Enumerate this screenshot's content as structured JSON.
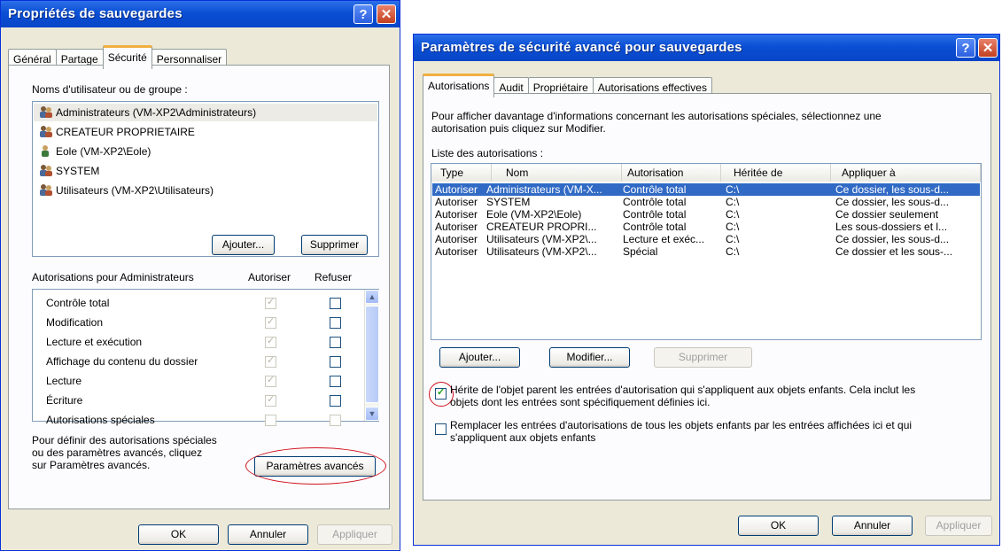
{
  "left": {
    "title": "Propriétés de sauvegardes",
    "tabs": [
      "Général",
      "Partage",
      "Sécurité",
      "Personnaliser"
    ],
    "group_label": "Noms d'utilisateur ou de groupe :",
    "users": [
      "Administrateurs (VM-XP2\\Administrateurs)",
      "CREATEUR PROPRIETAIRE",
      "Eole (VM-XP2\\Eole)",
      "SYSTEM",
      "Utilisateurs (VM-XP2\\Utilisateurs)"
    ],
    "add_button": "Ajouter...",
    "remove_button": "Supprimer",
    "perms_header": "Autorisations pour Administrateurs",
    "allow_header": "Autoriser",
    "deny_header": "Refuser",
    "permissions": [
      "Contrôle total",
      "Modification",
      "Lecture et exécution",
      "Affichage du contenu du dossier",
      "Lecture",
      "Écriture",
      "Autorisations spéciales"
    ],
    "advanced_text": [
      "Pour définir des autorisations spéciales",
      "ou des paramètres avancés, cliquez",
      "sur Paramètres avancés."
    ],
    "advanced_button": "Paramètres avancés",
    "ok": "OK",
    "cancel": "Annuler",
    "apply": "Appliquer"
  },
  "right": {
    "title": "Paramètres de sécurité avancé pour sauvegardes",
    "tabs": [
      "Autorisations",
      "Audit",
      "Propriétaire",
      "Autorisations effectives"
    ],
    "info": [
      "Pour afficher davantage d'informations concernant les autorisations spéciales, sélectionnez une",
      "autorisation puis cliquez sur Modifier."
    ],
    "list_label": "Liste des autorisations :",
    "columns": [
      "Type",
      "Nom",
      "Autorisation",
      "Héritée de",
      "Appliquer à"
    ],
    "rows": [
      [
        "Autoriser",
        "Administrateurs (VM-X...",
        "Contrôle total",
        "C:\\",
        "Ce dossier, les sous-d..."
      ],
      [
        "Autoriser",
        "SYSTEM",
        "Contrôle total",
        "C:\\",
        "Ce dossier, les sous-d..."
      ],
      [
        "Autoriser",
        "Eole (VM-XP2\\Eole)",
        "Contrôle total",
        "C:\\",
        "Ce dossier seulement"
      ],
      [
        "Autoriser",
        "CREATEUR PROPRI...",
        "Contrôle total",
        "C:\\",
        "Les sous-dossiers et l..."
      ],
      [
        "Autoriser",
        "Utilisateurs (VM-XP2\\...",
        "Lecture et exéc...",
        "C:\\",
        "Ce dossier, les sous-d..."
      ],
      [
        "Autoriser",
        "Utilisateurs (VM-XP2\\...",
        "Spécial",
        "C:\\",
        "Ce dossier et les sous-..."
      ]
    ],
    "add_button": "Ajouter...",
    "modify_button": "Modifier...",
    "remove_button": "Supprimer",
    "inherit_text": [
      "Hérite de l'objet parent les entrées d'autorisation qui s'appliquent aux objets enfants. Cela inclut les",
      "objets dont les entrées sont spécifiquement définies ici."
    ],
    "replace_text": [
      "Remplacer les entrées d'autorisations de tous les objets enfants par les entrées affichées ici et qui",
      "s'appliquent aux objets enfants"
    ],
    "ok": "OK",
    "cancel": "Annuler",
    "apply": "Appliquer"
  }
}
